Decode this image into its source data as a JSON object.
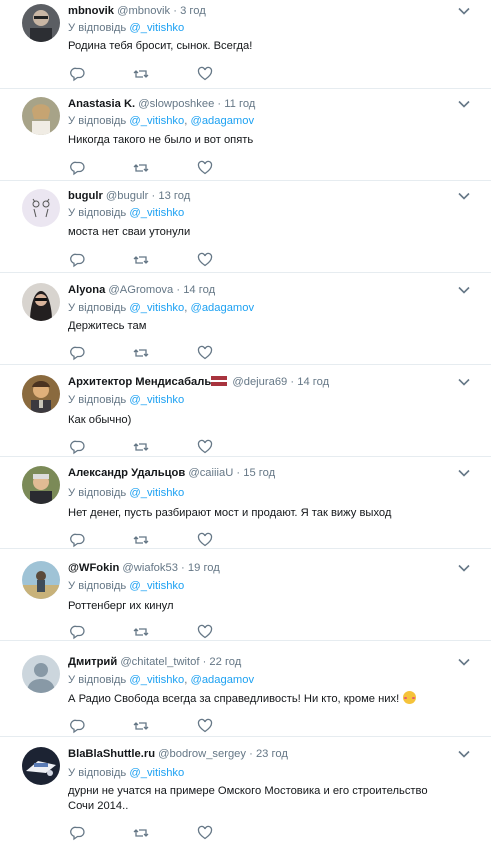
{
  "reply_prefix": "У відповідь",
  "tweets": [
    {
      "name": "mbnovik",
      "handle": "@mbnovik",
      "dot": "·",
      "time": "3 год",
      "mentions": [
        "@_vitishko"
      ],
      "text": "Родина тебя бросит, сынок. Всегда!"
    },
    {
      "name": "Anastasia K.",
      "handle": "@slowposhkee",
      "dot": "·",
      "time": "11 год",
      "mentions": [
        "@_vitishko",
        "@adagamov"
      ],
      "text": "Никогда такого не было и вот опять"
    },
    {
      "name": "bugulr",
      "handle": "@bugulr",
      "dot": "·",
      "time": "13 год",
      "mentions": [
        "@_vitishko"
      ],
      "text": "моста нет сваи утонули"
    },
    {
      "name": "Alyona",
      "handle": "@AGromova",
      "dot": "·",
      "time": "14 год",
      "mentions": [
        "@_vitishko",
        "@adagamov"
      ],
      "text": "Держитесь там"
    },
    {
      "name": "Архитектор Мендисабаль",
      "handle": "@dejura69",
      "dot": "·",
      "time": "14 год",
      "mentions": [
        "@_vitishko"
      ],
      "text": "Как обычно)"
    },
    {
      "name": "Александр Удальцов",
      "handle": "@caiiiaU",
      "dot": "·",
      "time": "15 год",
      "mentions": [
        "@_vitishko"
      ],
      "text": "Нет денег, пусть разбирают мост и продают. Я так вижу выход"
    },
    {
      "name": "@WFokin",
      "handle": "@wiafok53",
      "dot": "·",
      "time": "19 год",
      "mentions": [
        "@_vitishko"
      ],
      "text": "Роттенберг их кинул"
    },
    {
      "name": "Дмитрий",
      "handle": "@chitatel_twitof",
      "dot": "·",
      "time": "22 год",
      "mentions": [
        "@_vitishko",
        "@adagamov"
      ],
      "text": "А Радио Свобода всегда за справедливость! Ни кто, кроме них!"
    },
    {
      "name": "BlaBlaShuttle.ru",
      "handle": "@bodrow_sergey",
      "dot": "·",
      "time": "23 год",
      "mentions": [
        "@_vitishko"
      ],
      "text": "дурни не учатся на  примере Омского Мостовика и его строительство Сочи 2014.."
    }
  ],
  "icons": {
    "reply": "reply-icon",
    "retweet": "retweet-icon",
    "like": "heart-icon",
    "caret": "chevron-down-icon",
    "flag": "latvia-flag-icon",
    "emoji": "smiling-face-icon"
  },
  "colors": {
    "link": "#1da1f2",
    "muted": "#657786",
    "text": "#14171a",
    "divider": "#e6ecf0"
  }
}
